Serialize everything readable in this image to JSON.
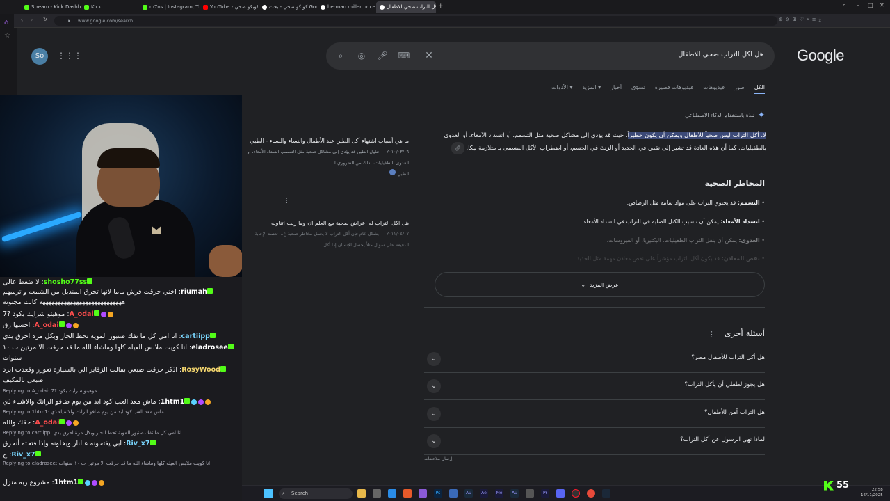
{
  "tabs": [
    {
      "label": "Stream - Kick Dashboard",
      "color": "#53fc18"
    },
    {
      "label": "Kick",
      "color": "#53fc18"
    },
    {
      "label": "m7ns | Instagram, TikTok |",
      "color": "#53fc18"
    },
    {
      "label": "YouTube - كوبكو صحي",
      "color": "#ff0000"
    },
    {
      "label": "كوبكو صحي - بحث Google",
      "color": "#ffffff"
    },
    {
      "label": "herman miller price - Goo",
      "color": "#ff5b5b"
    },
    {
      "label": "هل اكل التراب صحي للاطفال",
      "color": "#8ab4f8",
      "active": true
    }
  ],
  "address": {
    "url": "www.google.com/search"
  },
  "google": {
    "logo": "Google",
    "query": "هل اكل التراب صحي للاطفال",
    "avatar": "So",
    "nav": [
      "الكل",
      "صور",
      "فيديوهات",
      "فيديوهات قصيرة",
      "تسوّق",
      "أخبار",
      "المزيد",
      "الأدوات"
    ],
    "ai_header": "نبذة باستخدام الذكاء الاصطناعي",
    "ai_highlight": "لا، أكل التراب ليس صحياً للأطفال ويمكن أن يكون خطيراً",
    "ai_rest": "، حيث قد يؤدي إلى مشاكل صحية مثل التسمم، أو انسداد الأمعاء، أو العدوى بالطفيليات. كما أن هذه العادة قد تشير إلى نقص في الحديد أو الزنك في الجسم، أو اضطراب الأكل المسمى بـ متلازمة بيكا.",
    "risks_title": "المخاطر الصحية",
    "risks": [
      {
        "term": "التسمم:",
        "text": " قد يحتوي التراب على مواد سامة مثل الرصاص."
      },
      {
        "term": "انسداد الأمعاء:",
        "text": " يمكن أن تتسبب الكتل الصلبة في التراب في انسداد الأمعاء."
      },
      {
        "term": "العدوى:",
        "text": " يمكن أن ينقل التراب الطفيليات، البكتيريا، أو الفيروسات."
      },
      {
        "term": "نقص المعادن:",
        "text": " قد يكون أكل التراب مؤشراً على نقص معادن مهمة مثل الحديد."
      }
    ],
    "show_more": "عرض المزيد",
    "side": [
      {
        "q": "ما هي أسباب اشتهاء أكل الطين عند الأطفال والنساء والنساء - الطبي",
        "meta": "٢٠١٠/٠٣/٠٦ — تناول الطين قد يؤدي إلى مشاكل صحية مثل التسمم، انسداد الأمعاء، أو العدوى بالطفيليات، لذلك من الضروري ا...",
        "src": "الطبي"
      },
      {
        "q": "هل اكل التراب له اعراض صحية مع العلم ان وما زلت اتناوله",
        "meta": "٢٠١١/٠٤/٠٧ — بشكل عام فإن أكل التراب لا يحمل مخاطر صحية ع... تعتمد الإجابة الدقيقة على سؤال مثلاً يحصل للإنسان إذا أكل...",
        "src": ""
      }
    ],
    "paa_title": "أسئلة أخرى",
    "paa": [
      "هل أكل التراب للأطفال مضر؟",
      "هل يجوز لطفلي أن يأكل التراب؟",
      "هل التراب آمن للأطفال؟",
      "لماذا نهى الرسول عن أكل التراب؟"
    ],
    "feedback": "إرسال ملاحظات"
  },
  "chat": [
    {
      "user": "shosho77ss",
      "color": "#53fc18",
      "text": "لا ضغط عالي",
      "badges": []
    },
    {
      "user": "riumah",
      "color": "#ffffff",
      "text": "اختي حرقت فرش ماما لانها تحرق المنديل من الشمعه و ترميهم هههههههههههههههههههههههههههه كانت مجنونه",
      "badges": []
    },
    {
      "user": "A_odai",
      "color": "#ff4d4d",
      "text": "موهيتو شرايك بكود ?7",
      "badges": [
        "#f5a623",
        "#b04bff"
      ]
    },
    {
      "user": "A_odai",
      "color": "#ff4d4d",
      "text": "احسها زق",
      "badges": [
        "#f5a623",
        "#b04bff"
      ]
    },
    {
      "user": "cartiipp",
      "color": "#7ad7ff",
      "text": "انا امي كل ما تفك صنبور الموية تحط الحار وبكل مرة احرق يدي",
      "badges": []
    },
    {
      "user": "eladrosee",
      "color": "#ffffff",
      "text": "انا كويت ملابس العيله كلها وماشاء الله ما قد حرقت الا مرتين ب ١٠ سنوات",
      "badges": []
    },
    {
      "user": "RosyWood",
      "color": "#f5d76e",
      "text": "اذكر حرقت صبعي بمالت الزقاير الي بالسيارة تعورر وقعدت ابرد صبعي بالمكيف",
      "badges": []
    },
    {
      "reply": "Replying to A_odai: موهيتو شرايك بكود ?7"
    },
    {
      "user": "1htm1",
      "color": "#ffffff",
      "text": "ماش معد العب كود ابد من يوم ضافو الرانك والاشياء ذي",
      "badges": [
        "#f5a623",
        "#b04bff",
        "#5ad1ff"
      ]
    },
    {
      "reply": "Replying to 1htm1: ماش معد العب كود ابد من يوم ضافو الرانك والاشياء ذي"
    },
    {
      "user": "A_odai",
      "color": "#ff4d4d",
      "text": "حقك والله",
      "badges": [
        "#f5a623",
        "#b04bff"
      ]
    },
    {
      "reply": "Replying to cartiipp: انا امي كل ما تفك صنبور الموية تحط الحار وبكل مرة احرق يدي"
    },
    {
      "user": "Riv_x7",
      "color": "#7ad7ff",
      "text": "ابي يفتحونه عالنار ويخلونه وإذا فتحته أنحرق",
      "badges": []
    },
    {
      "user": "Riv_x7",
      "color": "#7ad7ff",
      "text": "ح",
      "badges": []
    },
    {
      "reply": "Replying to eladrosee: انا كويت ملابس العيله كلها وماشاء الله ما قد حرقت الا مرتين ب ١٠ سنوات"
    },
    {
      "user": "1htm1",
      "color": "#ffffff",
      "text": "مشروع ربه منزل",
      "badges": [
        "#f5a623",
        "#b04bff",
        "#5ad1ff"
      ]
    }
  ],
  "taskbar": {
    "search": "Search"
  },
  "kick": {
    "viewers": "55"
  },
  "clock": {
    "time": "22:58",
    "date": "16/11/2025"
  }
}
